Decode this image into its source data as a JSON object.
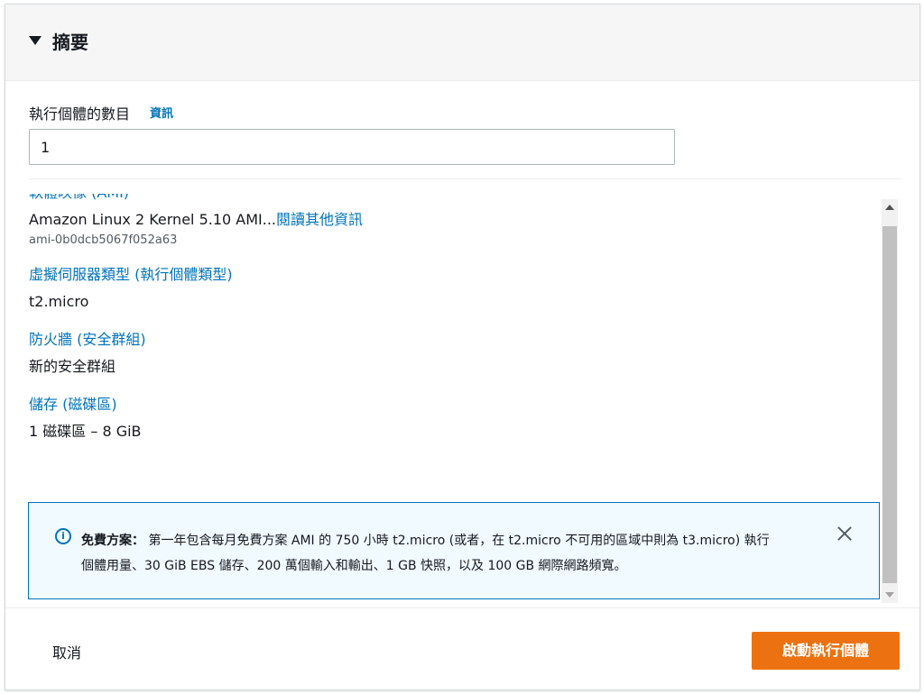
{
  "summary": {
    "title": "摘要"
  },
  "instance_count": {
    "label": "執行個體的數目",
    "info_link": "資訊",
    "value": "1"
  },
  "sections": {
    "ami": {
      "label": "軟體映像 (AMI)",
      "value": "Amazon Linux 2 Kernel 5.10 AMI...",
      "more_link": "閱讀其他資訊",
      "ami_id": "ami-0b0dcb5067f052a63"
    },
    "instance_type": {
      "label": "虛擬伺服器類型 (執行個體類型)",
      "value": "t2.micro"
    },
    "firewall": {
      "label": "防火牆 (安全群組)",
      "value": "新的安全群組"
    },
    "storage": {
      "label": "儲存 (磁碟區)",
      "value": "1 磁碟區 – 8 GiB"
    }
  },
  "alert": {
    "icon": "info-icon",
    "title": "免費方案：",
    "text_line1": "第一年包含每月免費方案 AMI 的 750 小時 t2.micro (或者，在 t2.micro 不可用的區域中則為 t3.micro) 執行",
    "text_line2": "個體用量、30 GiB EBS 儲存、200 萬個輸入和輸出、1 GB 快照，以及 100 GB 網際網路頻寬。"
  },
  "footer": {
    "cancel_label": "取消",
    "launch_label": "啟動執行個體"
  },
  "colors": {
    "link": "#0073bb",
    "primary_button": "#ec7211",
    "alert_background": "#f1faff"
  }
}
